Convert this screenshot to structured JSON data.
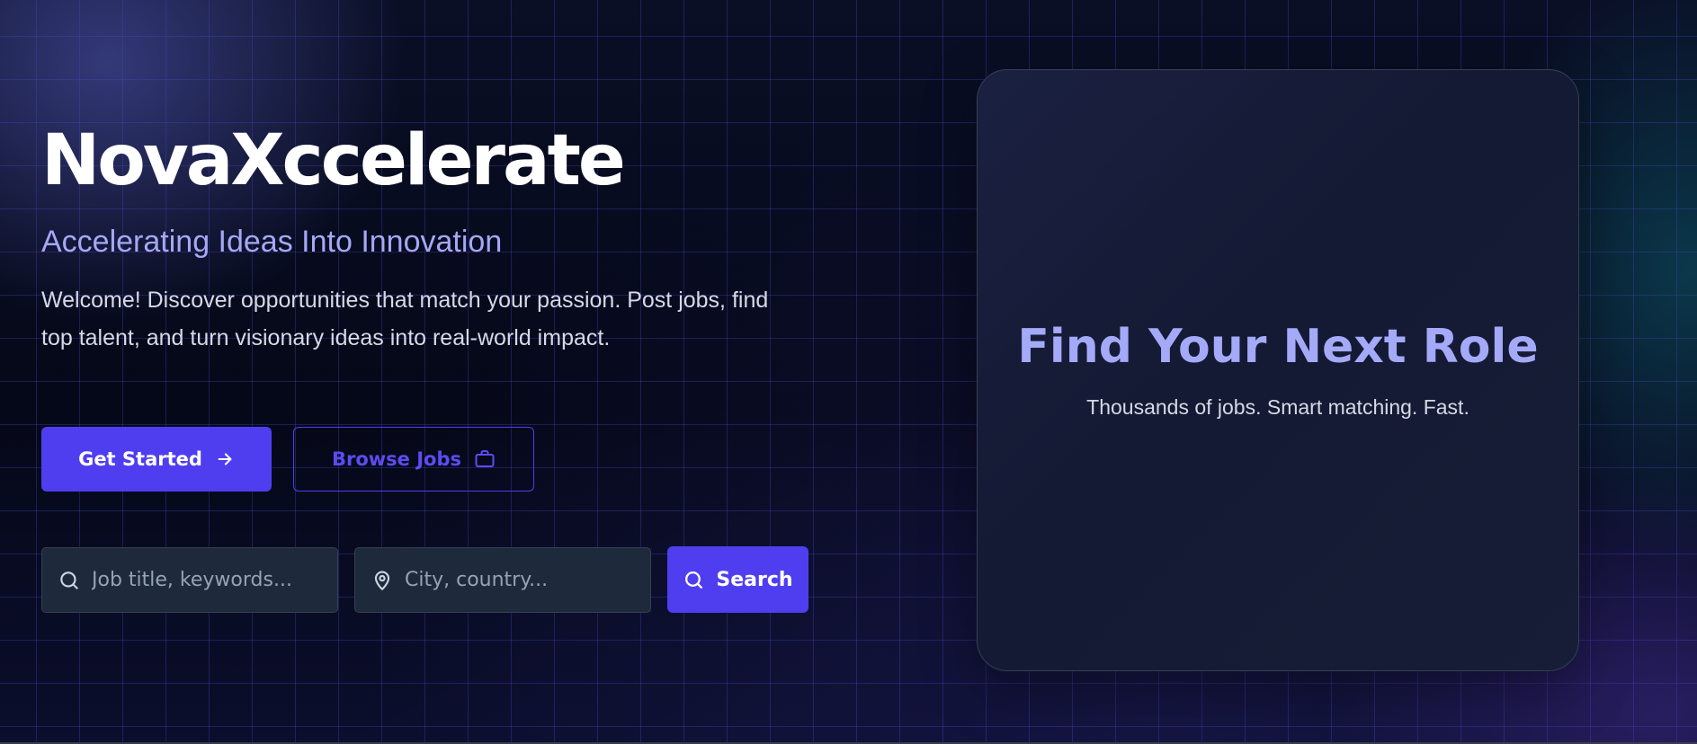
{
  "hero": {
    "brand": "NovaXccelerate",
    "tagline": "Accelerating Ideas Into Innovation",
    "welcome": "Welcome! Discover opportunities that match your passion. Post jobs, find top talent, and turn visionary ideas into real-world impact."
  },
  "buttons": {
    "get_started": "Get Started",
    "browse_jobs": "Browse Jobs"
  },
  "search": {
    "job_placeholder": "Job title, keywords...",
    "location_placeholder": "City, country...",
    "button_label": "Search"
  },
  "promo": {
    "title": "Find Your Next Role",
    "subtitle": "Thousands of jobs. Smart matching. Fast."
  },
  "icons": {
    "get_started": "arrow-right-icon",
    "browse_jobs": "briefcase-icon",
    "job_field": "search-icon",
    "location_field": "map-pin-icon",
    "search_button": "search-icon"
  },
  "colors": {
    "accent": "#4f3ef0",
    "tagline": "#a4a8f6",
    "background": "#070b1c",
    "card": "#161c36",
    "field": "#1e293b"
  }
}
